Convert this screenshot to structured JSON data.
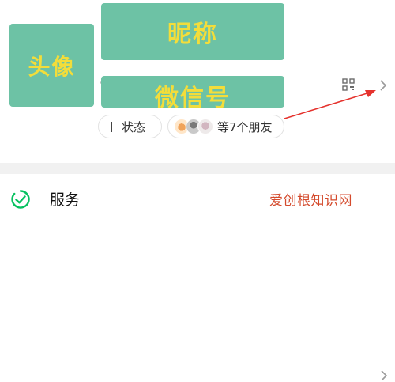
{
  "profile": {
    "avatar_label": "头像",
    "nickname_label": "昵称",
    "wechat_id_label": "微信号",
    "status_button": "状态",
    "friends_text": "等7个朋友"
  },
  "menu": {
    "service_label": "服务"
  },
  "watermark": "爱创根知识网",
  "colors": {
    "placeholder_block": "#6dc2a5",
    "placeholder_text": "#f3dd3a",
    "annotation_arrow": "#e5322d",
    "service_icon": "#07c160",
    "divider": "#f1f1f1"
  },
  "icons": {
    "qr": "qr-code-icon",
    "chevron": "chevron-right-icon",
    "service": "service-check-icon",
    "plus": "plus-icon"
  }
}
